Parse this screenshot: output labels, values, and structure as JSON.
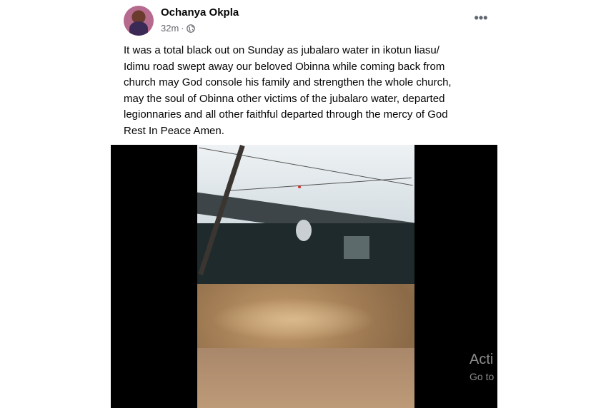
{
  "post": {
    "author": "Ochanya Okpla",
    "time": "32m",
    "separator": "·",
    "privacy_icon": "globe-icon",
    "more_icon": "more-options-icon",
    "more_label": "•••",
    "text": "It was a total black out on Sunday as jubalaro water in ikotun liasu/\nIdimu road swept away our beloved Obinna while coming back from\nchurch may God console his family and strengthen the whole church,\nmay the soul of Obinna other victims of the jubalaro water, departed\nlegionnaries and all other faithful departed through the mercy of God\nRest In Peace Amen."
  },
  "overlay": {
    "watermark_line1": "Acti",
    "watermark_line2": "Go to"
  },
  "colors": {
    "secondary_text": "#65676b",
    "primary_text": "#050505",
    "media_bg": "#000000"
  }
}
